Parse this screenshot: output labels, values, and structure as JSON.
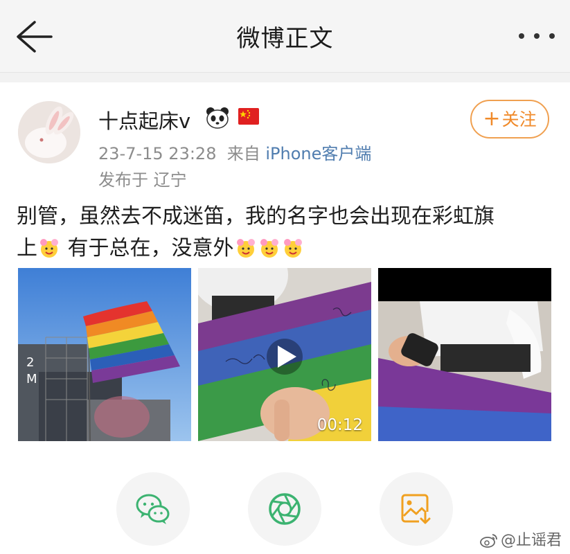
{
  "header": {
    "title": "微博正文",
    "back_icon": "arrow-left-icon",
    "more_icon": "more-dots-icon"
  },
  "post": {
    "author": "十点起床v",
    "badges": [
      "panda-emoji-icon",
      "china-flag-icon"
    ],
    "time": "23-7-15 23:28",
    "source_prefix": "来自",
    "source": "iPhone客户端",
    "location_prefix": "发布于",
    "location": "辽宁",
    "follow_label": "关注",
    "text_line1": "别管，虽然去不成迷笛，我的名字也会出现在彩虹旗",
    "text_line2_start": "上",
    "text_line2_mid": " 有于总在，没意外"
  },
  "media": {
    "video_duration": "00:12",
    "images": [
      "rainbow-flag-stage-photo",
      "flag-signing-video",
      "flag-closeup-photo"
    ]
  },
  "share": {
    "items": [
      "wechat-icon",
      "moments-icon",
      "save-image-icon"
    ]
  },
  "watermark": {
    "text": "@止谣君",
    "icon": "weibo-logo-icon"
  },
  "colors": {
    "accent_orange": "#f08a2a",
    "link_blue": "#507daf",
    "wechat_green": "#3cb371",
    "save_orange": "#f0a020"
  }
}
